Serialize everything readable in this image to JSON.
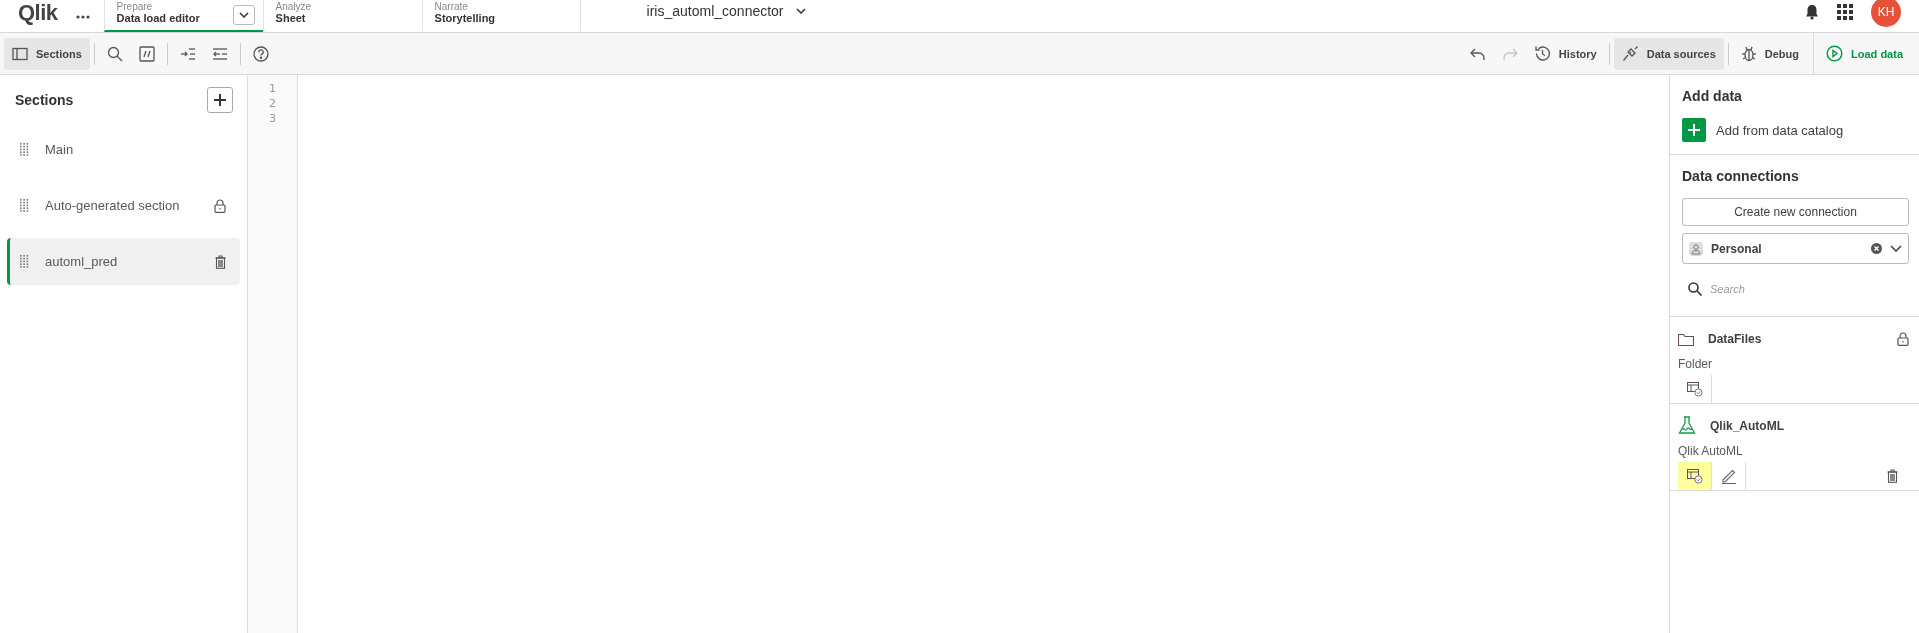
{
  "app_bar": {
    "logo": "Qlik",
    "tabs": [
      {
        "group": "Prepare",
        "label": "Data load editor",
        "selected": true,
        "has_menu": true
      },
      {
        "group": "Analyze",
        "label": "Sheet",
        "selected": false,
        "has_menu": false
      },
      {
        "group": "Narrate",
        "label": "Storytelling",
        "selected": false,
        "has_menu": false
      }
    ],
    "app_title": "iris_automl_connector",
    "avatar": "KH"
  },
  "toolbar": {
    "left": [
      {
        "kind": "sections",
        "label": "Sections",
        "selected": true
      },
      {
        "kind": "search"
      },
      {
        "kind": "comment"
      },
      {
        "kind": "indent"
      },
      {
        "kind": "outdent"
      },
      {
        "kind": "help"
      }
    ],
    "right": [
      {
        "kind": "undo",
        "disabled": false
      },
      {
        "kind": "redo",
        "disabled": true
      },
      {
        "kind": "history",
        "label": "History",
        "selected": false
      },
      {
        "kind": "datasources",
        "label": "Data sources",
        "selected": true
      },
      {
        "kind": "debug",
        "label": "Debug",
        "selected": false
      },
      {
        "kind": "load",
        "label": "Load data",
        "selected": false
      }
    ]
  },
  "sections": {
    "title": "Sections",
    "items": [
      {
        "label": "Main",
        "selected": false,
        "locked": false,
        "deletable": false
      },
      {
        "label": "Auto-generated section",
        "selected": false,
        "locked": true,
        "deletable": false
      },
      {
        "label": "automl_pred",
        "selected": true,
        "locked": false,
        "deletable": true
      }
    ]
  },
  "editor": {
    "line_numbers": [
      "1",
      "2",
      "3"
    ]
  },
  "data_panel": {
    "title": "Add data",
    "catalog_button": "Add from data catalog",
    "connections_title": "Data connections",
    "create_button": "Create new connection",
    "space_select": {
      "value": "Personal"
    },
    "search": {
      "placeholder": "Search"
    },
    "connections": [
      {
        "kind": "folder",
        "name": "DataFiles",
        "type": "Folder",
        "locked": true,
        "actions": [
          {
            "kind": "select",
            "highlighted": false
          }
        ]
      },
      {
        "kind": "automl",
        "name": "Qlik_AutoML",
        "type": "Qlik AutoML",
        "locked": false,
        "actions": [
          {
            "kind": "select",
            "highlighted": true
          },
          {
            "kind": "edit",
            "highlighted": false
          },
          {
            "kind": "delete",
            "highlighted": false
          }
        ]
      }
    ]
  }
}
